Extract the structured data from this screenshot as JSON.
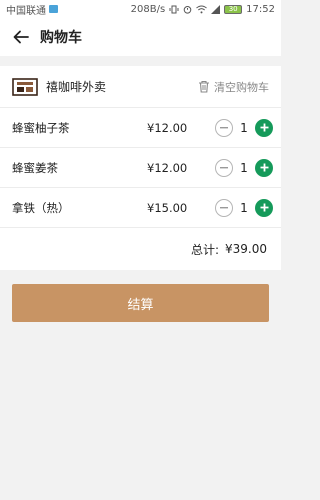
{
  "status_bar": {
    "carrier": "中国联通",
    "speed": "208B/s",
    "battery": "30",
    "time": "17:52"
  },
  "header": {
    "title": "购物车"
  },
  "shop": {
    "name": "禧咖啡外卖",
    "clear_label": "清空购物车"
  },
  "items": [
    {
      "name": "蜂蜜柚子茶",
      "price": "¥12.00",
      "qty": "1"
    },
    {
      "name": "蜂蜜姜茶",
      "price": "¥12.00",
      "qty": "1"
    },
    {
      "name": "拿铁（热）",
      "price": "¥15.00",
      "qty": "1"
    }
  ],
  "total": {
    "label": "总计:",
    "value": "¥39.00"
  },
  "checkout": {
    "label": "结算"
  },
  "colors": {
    "accent": "#c89464",
    "plus": "#159a5a",
    "background": "#f2f2f2"
  }
}
